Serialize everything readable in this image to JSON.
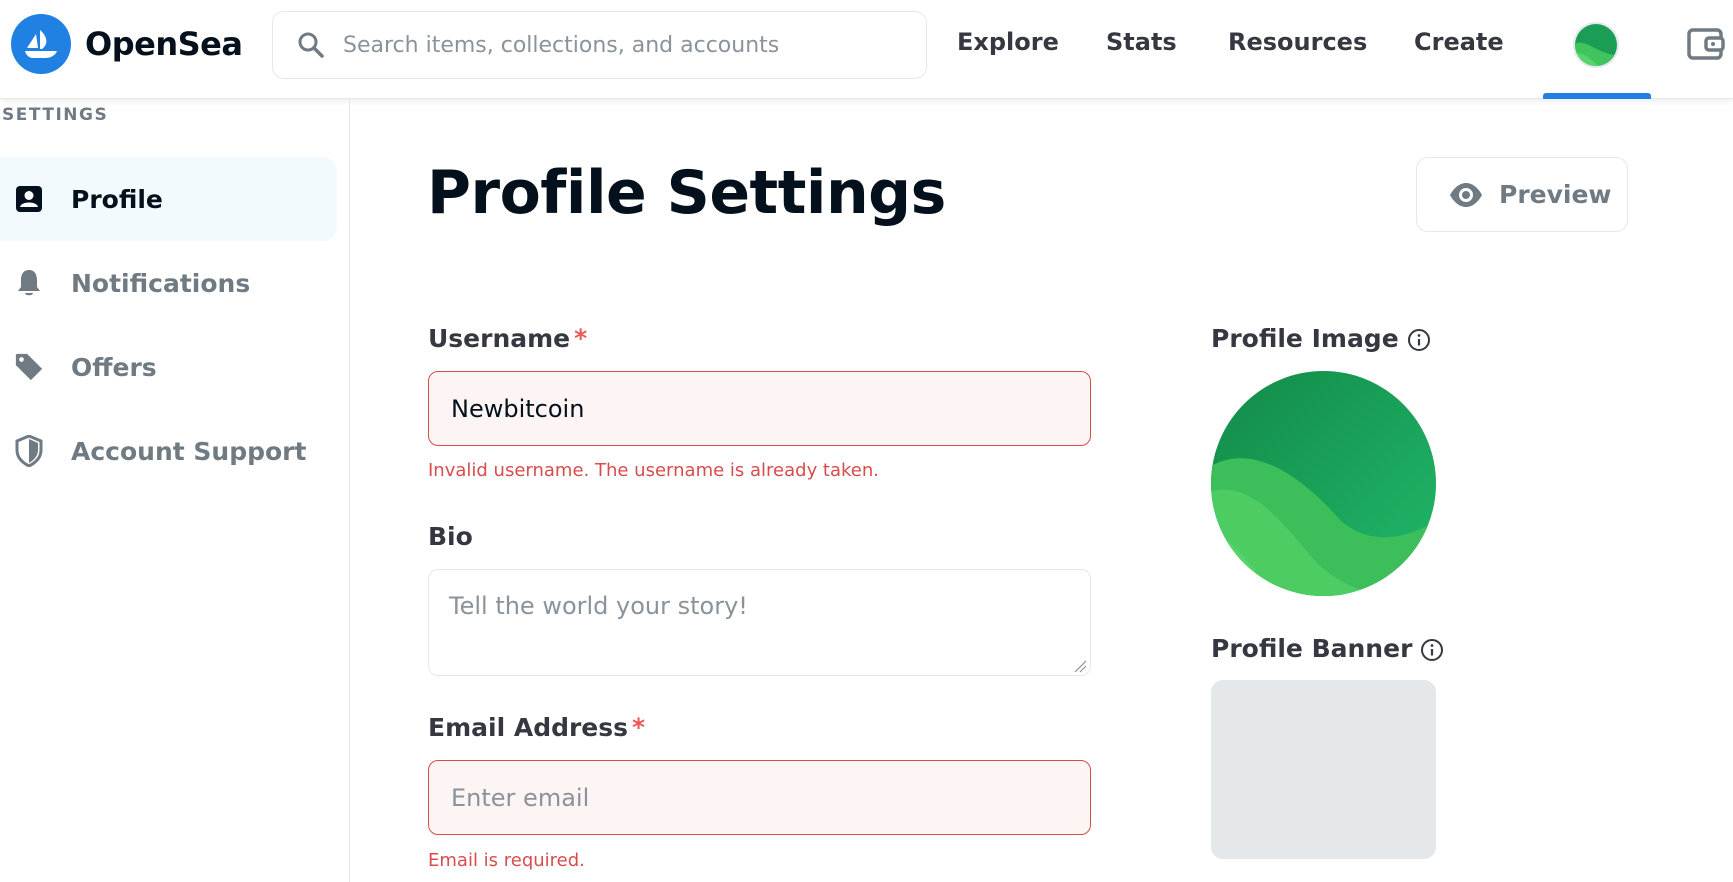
{
  "header": {
    "brand": "OpenSea",
    "search_placeholder": "Search items, collections, and accounts",
    "nav": [
      "Explore",
      "Stats",
      "Resources",
      "Create"
    ],
    "accent_color": "#2081e2"
  },
  "sidebar": {
    "heading": "SETTINGS",
    "items": [
      {
        "label": "Profile",
        "icon": "profile-icon",
        "active": true
      },
      {
        "label": "Notifications",
        "icon": "bell-icon",
        "active": false
      },
      {
        "label": "Offers",
        "icon": "tag-icon",
        "active": false
      },
      {
        "label": "Account Support",
        "icon": "shield-icon",
        "active": false
      }
    ]
  },
  "main": {
    "title": "Profile Settings",
    "preview_label": "Preview",
    "username": {
      "label": "Username",
      "required_mark": "*",
      "value": "Newbitcoin",
      "error": "Invalid username. The username is already taken."
    },
    "bio": {
      "label": "Bio",
      "placeholder": "Tell the world your story!"
    },
    "email": {
      "label": "Email Address",
      "required_mark": "*",
      "placeholder": "Enter email",
      "error": "Email is required."
    },
    "profile_image_label": "Profile Image",
    "profile_banner_label": "Profile Banner",
    "error_color": "#d94c4c"
  }
}
